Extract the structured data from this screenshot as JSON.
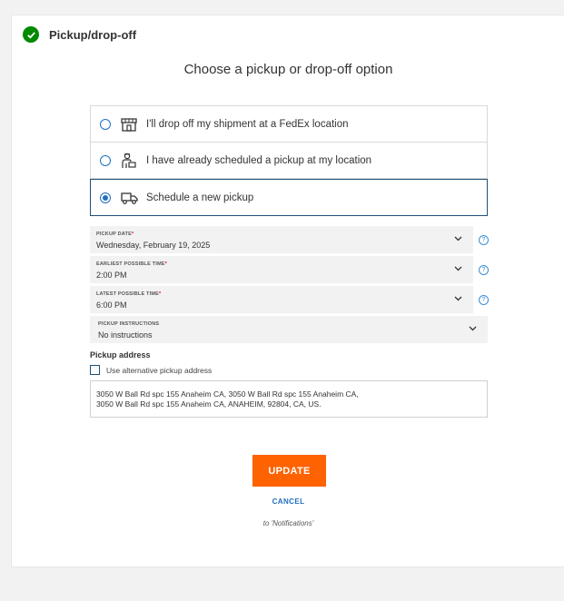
{
  "header": {
    "title": "Pickup/drop-off"
  },
  "subtitle": "Choose a pickup or drop-off option",
  "options": [
    {
      "label": "I'll drop off my shipment at a FedEx location",
      "icon": "store-icon",
      "selected": false
    },
    {
      "label": "I have already scheduled a pickup at my location",
      "icon": "courier-icon",
      "selected": false
    },
    {
      "label": "Schedule a new pickup",
      "icon": "truck-icon",
      "selected": true
    }
  ],
  "fields": {
    "pickup_date": {
      "label": "PICKUP DATE",
      "required": "*",
      "value": "Wednesday, February 19, 2025"
    },
    "earliest_time": {
      "label": "EARLIEST POSSIBLE TIME",
      "required": "*",
      "value": "2:00 PM"
    },
    "latest_time": {
      "label": "LATEST POSSIBLE TIME",
      "required": "*",
      "value": "6:00 PM"
    },
    "instructions": {
      "label": "PICKUP INSTRUCTIONS",
      "value": "No instructions"
    }
  },
  "help_glyph": "?",
  "pickup_address": {
    "title": "Pickup address",
    "alt_label": "Use alternative pickup address",
    "line1": "3050 W Ball Rd spc 155 Anaheim CA, 3050 W Ball Rd spc 155 Anaheim CA,",
    "line2": "3050 W Ball Rd spc 155 Anaheim CA, ANAHEIM, 92804, CA, US."
  },
  "buttons": {
    "update": "UPDATE",
    "cancel": "CANCEL"
  },
  "note": "to 'Notifications'",
  "colors": {
    "accent": "#ff6200",
    "link": "#1f6fbf",
    "success": "#008a00",
    "required": "#de002e"
  }
}
